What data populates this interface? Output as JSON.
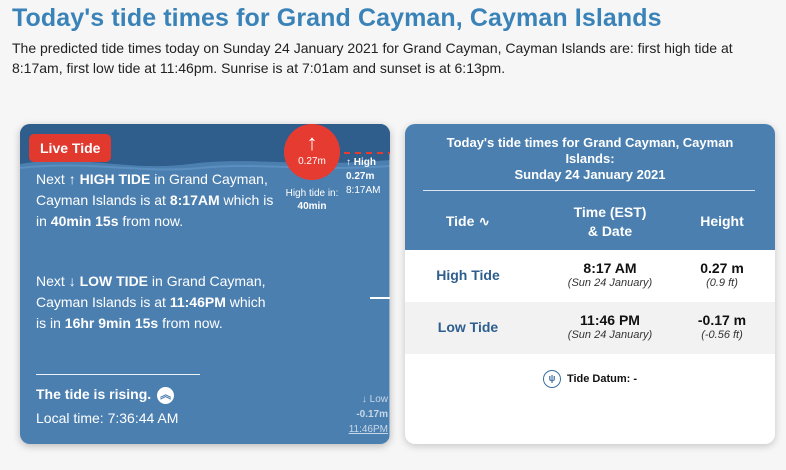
{
  "page": {
    "title": "Today's tide times for Grand Cayman, Cayman Islands",
    "intro": "The predicted tide times today on Sunday 24 January 2021 for Grand Cayman, Cayman Islands are: first high tide at 8:17am, first low tide at 11:46pm. Sunrise is at 7:01am and sunset is at 6:13pm."
  },
  "live": {
    "badge": "Live Tide",
    "high": {
      "prefix": "Next ",
      "arrow": "↑",
      "label": "HIGH TIDE",
      "place": " in Grand Cayman, Cayman Islands is at ",
      "time": "8:17AM",
      "mid": " which is in ",
      "countdown": "40min 15s",
      "suffix": " from now."
    },
    "low": {
      "prefix": "Next ",
      "arrow": "↓",
      "label": "LOW TIDE",
      "place": " in Grand Cayman, Cayman Islands is at ",
      "time": "11:46PM",
      "mid": " which is in ",
      "countdown": "16hr 9min 15s",
      "suffix": " from now."
    },
    "rising": "The tide is rising.",
    "local_time": "Local time: 7:36:44 AM",
    "circle_arrow": "↑",
    "circle_value": "0.27m",
    "hightide_in_label": "High tide in:",
    "hightide_in_value": "40min",
    "right_high_label": "↑ High",
    "right_high_value": "0.27m",
    "right_high_time": "8:17AM",
    "right_low_label": "↓ Low",
    "right_low_value": "-0.17m",
    "right_low_time": "11:46PM"
  },
  "table": {
    "title_line1": "Today's tide times for Grand Cayman, Cayman",
    "title_line2": "Islands:",
    "title_line3": "Sunday 24 January 2021",
    "col_tide": "Tide",
    "col_time_1": "Time (EST)",
    "col_time_2": "& Date",
    "col_height": "Height",
    "rows": [
      {
        "name": "High Tide",
        "time": "8:17 AM",
        "date": "(Sun 24 January)",
        "height": "0.27 m",
        "height_ft": "(0.9 ft)"
      },
      {
        "name": "Low Tide",
        "time": "11:46 PM",
        "date": "(Sun 24 January)",
        "height": "-0.17 m",
        "height_ft": "(-0.56 ft)"
      }
    ],
    "datum": "Tide Datum: -"
  }
}
